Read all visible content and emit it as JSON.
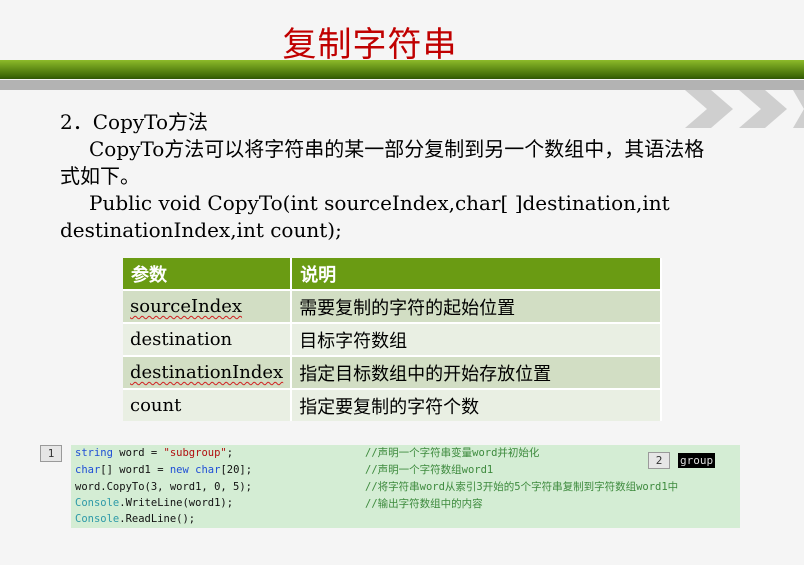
{
  "title": "复制字符串",
  "section": {
    "heading": "2．CopyTo方法",
    "desc_line1": "CopyTo方法可以将字符串的某一部分复制到另一个数组中，其语法格",
    "desc_line2": "式如下。",
    "syntax_line1": "Public void CopyTo(int sourceIndex,char[ ]destination,int",
    "syntax_line2": "destinationIndex,int count);"
  },
  "param_table": {
    "headers": [
      "参数",
      "说明"
    ],
    "rows": [
      {
        "name": "sourceIndex",
        "desc": "需要复制的字符的起始位置"
      },
      {
        "name": "destination",
        "desc": "目标字符数组"
      },
      {
        "name": "destinationIndex",
        "desc": "指定目标数组中的开始存放位置"
      },
      {
        "name": "count",
        "desc": "指定要复制的字符个数"
      }
    ]
  },
  "code": {
    "badge": "1",
    "line1": {
      "kw": "string",
      "rest": " word = ",
      "str": "\"subgroup\"",
      "end": ";"
    },
    "line2": {
      "kw": "char",
      "mid": "[] word1 = ",
      "kw2": "new",
      "sp": " ",
      "kw3": "char",
      "end": "[20];"
    },
    "line3": "word.CopyTo(3, word1, 0, 5);",
    "line4": {
      "type": "Console",
      "rest": ".WriteLine(word1);"
    },
    "line5": {
      "type": "Console",
      "rest": ".ReadLine();"
    },
    "comments": [
      "//声明一个字符串变量word并初始化",
      "//声明一个字符数组word1",
      "//将字符串word从索引3开始的5个字符串复制到字符数组word1中",
      "//输出字符数组中的内容"
    ]
  },
  "output": {
    "badge": "2",
    "text": "group"
  },
  "colors": {
    "title_red": "#c00000",
    "band_green": "#5a8a12",
    "table_header": "#6a9b13",
    "code_bg": "#d4edd4"
  }
}
